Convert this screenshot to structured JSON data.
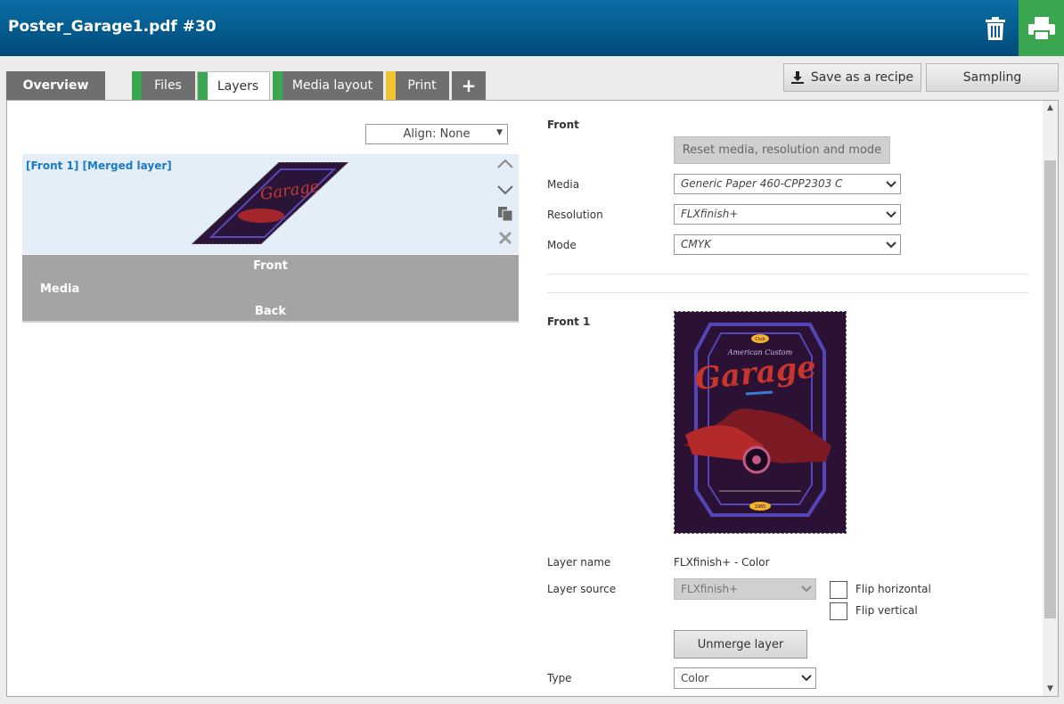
{
  "header": {
    "title": "Poster_Garage1.pdf #30",
    "trash_icon": "trash-icon",
    "print_icon": "printer-icon",
    "accent": "#3aa64f"
  },
  "tabs": [
    {
      "label": "Overview",
      "stripe": ""
    },
    {
      "label": "Files",
      "stripe": "#3aa64f"
    },
    {
      "label": "Layers",
      "stripe": "#3aa64f",
      "active": true
    },
    {
      "label": "Media layout",
      "stripe": "#3aa64f"
    },
    {
      "label": "Print",
      "stripe": "#f4c430"
    },
    {
      "label": "+",
      "stripe": ""
    }
  ],
  "toolbar": {
    "save_recipe_label": "Save as a recipe",
    "sampling_label": "Sampling"
  },
  "left": {
    "align_value": "Align: None",
    "layer_name": "[Front 1] [Merged layer]",
    "media": {
      "front_label": "Front",
      "media_label": "Media",
      "back_label": "Back"
    }
  },
  "right": {
    "front_heading": "Front",
    "reset_label": "Reset media, resolution and mode",
    "media_label": "Media",
    "media_value": "Generic Paper 460-CPP2303 C",
    "resolution_label": "Resolution",
    "resolution_value": "FLXfinish+",
    "mode_label": "Mode",
    "mode_value": "CMYK",
    "front1_heading": "Front 1",
    "poster": {
      "small_top": "Club",
      "script": "American Custom",
      "garage": "Garage",
      "year": "1965"
    },
    "layer_name_label": "Layer name",
    "layer_name_value": "FLXfinish+ - Color",
    "layer_source_label": "Layer source",
    "layer_source_value": "FLXfinish+",
    "flip_horizontal_label": "Flip horizontal",
    "flip_vertical_label": "Flip vertical",
    "unmerge_label": "Unmerge layer",
    "type_label": "Type",
    "type_value": "Color"
  }
}
